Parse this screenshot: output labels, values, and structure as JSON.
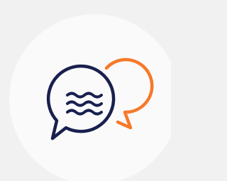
{
  "colors": {
    "page_background": "#f1f1f1",
    "disc": "#fafafa",
    "front_bubble": "#19204f",
    "back_bubble": "#f7792b",
    "bubble_fill": "#fafafa"
  },
  "icon": {
    "name": "chat-bubbles-waves-icon",
    "front": "speech-bubble",
    "back": "speech-bubble",
    "symbol": "three-wavy-lines"
  }
}
